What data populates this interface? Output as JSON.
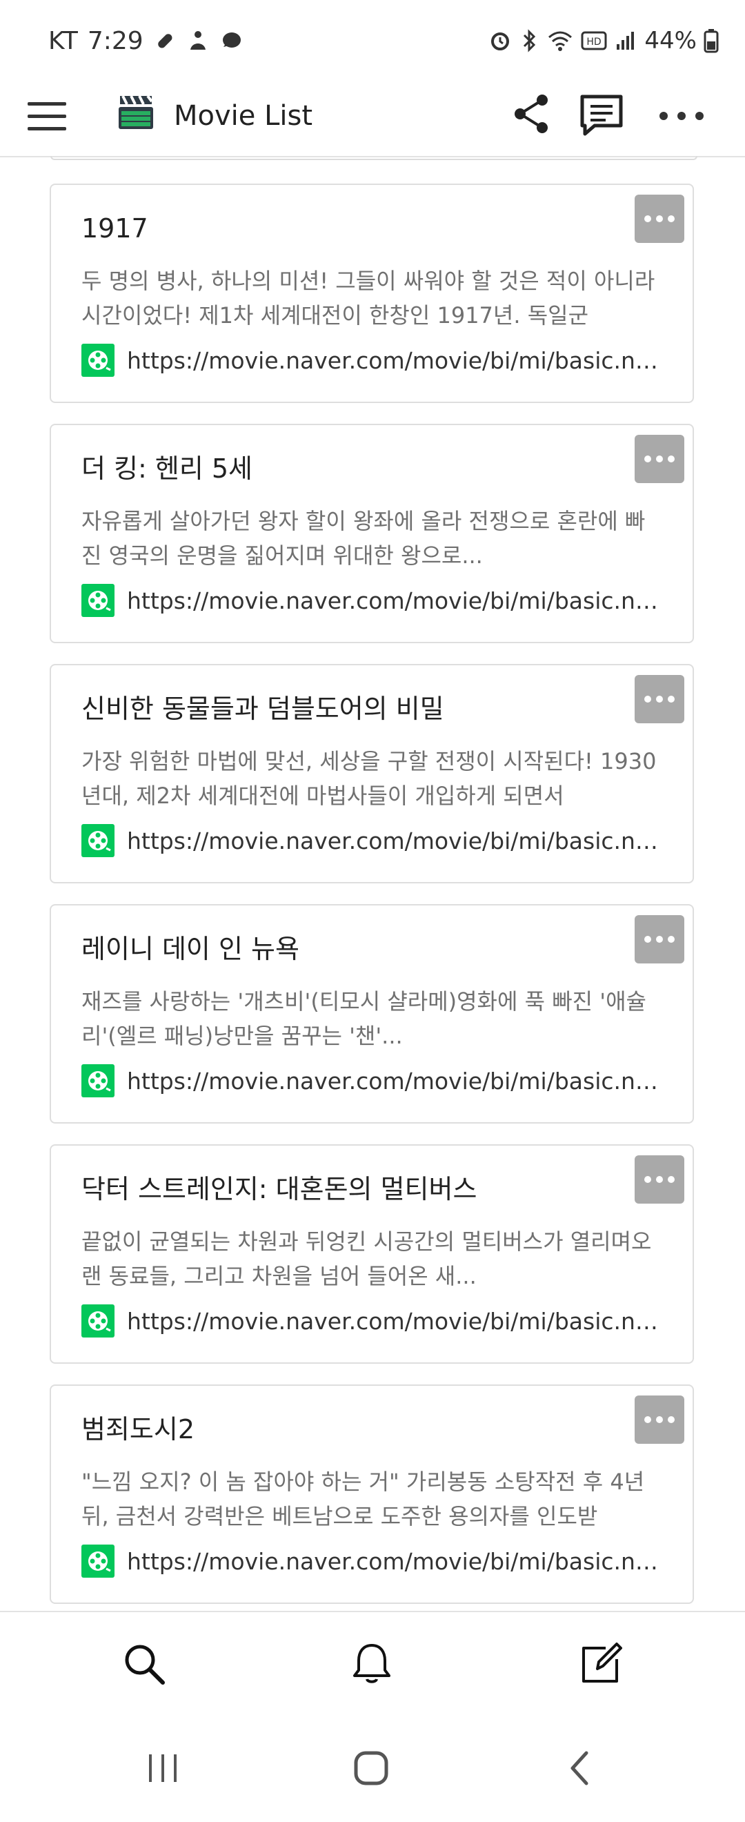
{
  "status_bar": {
    "carrier": "KT",
    "time": "7:29",
    "battery": "44%",
    "icons": [
      "pill-icon",
      "person-icon",
      "chat-bubble-icon",
      "alarm-icon",
      "bluetooth-icon",
      "wifi-icon",
      "hd-icon",
      "signal-icon",
      "battery-icon"
    ]
  },
  "app_bar": {
    "title": "Movie List",
    "icons": [
      "menu-icon",
      "clapperboard-icon",
      "share-icon",
      "comment-icon",
      "more-icon"
    ]
  },
  "movies": [
    {
      "title": "1917",
      "description": "두 명의 병사, 하나의 미션! 그들이 싸워야 할 것은 적이 아니라 시간이었다! 제1차 세계대전이 한창인 1917년. 독일군",
      "link": "https://movie.naver.com/movie/bi/mi/basic.naver?code=187321"
    },
    {
      "title": "더 킹: 헨리 5세",
      "description": "자유롭게 살아가던 왕자 할이 왕좌에 올라 전쟁으로 혼란에 빠진 영국의 운명을 짊어지며 위대한 왕으로...",
      "link": "https://movie.naver.com/movie/bi/mi/basic.naver?code=187322"
    },
    {
      "title": "신비한 동물들과 덤블도어의 비밀",
      "description": "가장 위험한 마법에 맞선, 세상을 구할 전쟁이 시작된다! 1930년대, 제2차 세계대전에 마법사들이 개입하게 되면서",
      "link": "https://movie.naver.com/movie/bi/mi/basic.naver?code=187323"
    },
    {
      "title": "레이니 데이 인 뉴욕",
      "description": "재즈를 사랑하는 '개츠비'(티모시 샬라메)영화에 푹 빠진 '애슐리'(엘르 패닝)낭만을 꿈꾸는 '챈'...",
      "link": "https://movie.naver.com/movie/bi/mi/basic.naver?code=187324"
    },
    {
      "title": "닥터 스트레인지: 대혼돈의 멀티버스",
      "description": "끝없이 균열되는 차원과 뒤엉킨 시공간의 멀티버스가 열리며오랜 동료들, 그리고 차원을 넘어 들어온 새...",
      "link": "https://movie.naver.com/movie/bi/mi/basic.naver?code=187325"
    },
    {
      "title": "범죄도시2",
      "description": "\"느낌 오지? 이 놈 잡아야 하는 거\" 가리봉동 소탕작전 후 4년 뒤, 금천서 강력반은 베트남으로 도주한 용의자를 인도받",
      "link": "https://movie.naver.com/movie/bi/mi/basic.naver?code=187326"
    }
  ],
  "bottom_bar": {
    "icons": [
      "search-icon",
      "bell-icon",
      "edit-icon"
    ]
  },
  "system_nav": {
    "icons": [
      "recent-apps-icon",
      "home-icon",
      "back-icon"
    ]
  },
  "colors": {
    "naver_green": "#03c75a",
    "card_border": "#dedede",
    "more_button": "#a9a9a9",
    "description_text": "#707070"
  }
}
